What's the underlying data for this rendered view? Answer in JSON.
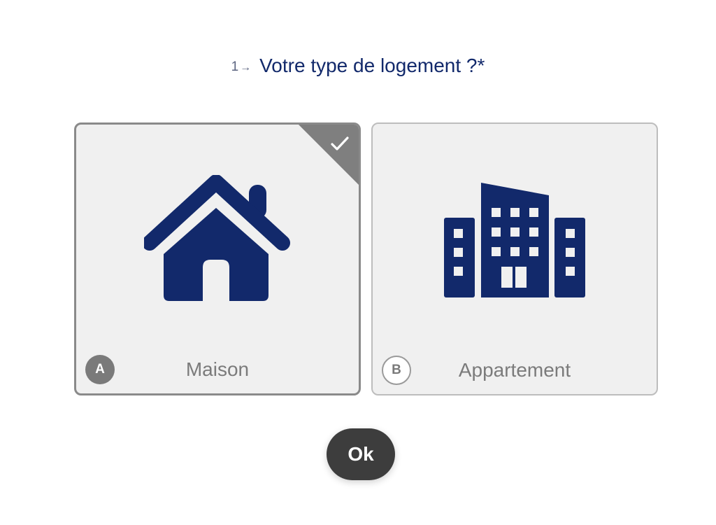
{
  "question": {
    "number": "1",
    "arrow": "→",
    "text": "Votre type de logement ?*"
  },
  "choices": [
    {
      "key": "A",
      "label": "Maison",
      "icon": "house-icon",
      "selected": true
    },
    {
      "key": "B",
      "label": "Appartement",
      "icon": "building-icon",
      "selected": false
    }
  ],
  "submit": {
    "label": "Ok"
  },
  "colors": {
    "accent": "#12296b",
    "card_background": "#f0f0f0",
    "selected_border": "#8a8a8a",
    "button_background": "#3d3d3d"
  }
}
